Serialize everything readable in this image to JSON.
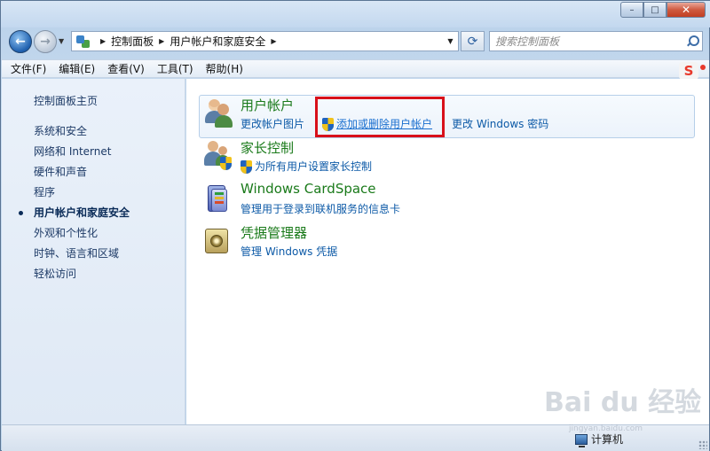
{
  "window": {
    "controls": {
      "minimize": "–",
      "maximize": "□",
      "close": "✕"
    }
  },
  "nav": {
    "back": "←",
    "forward": "→",
    "history_dropdown": "▼",
    "breadcrumb": [
      "控制面板",
      "用户帐户和家庭安全"
    ],
    "address_dropdown": "▼",
    "refresh": "⟳",
    "search_placeholder": "搜索控制面板"
  },
  "menubar": {
    "items": [
      "文件(F)",
      "编辑(E)",
      "查看(V)",
      "工具(T)",
      "帮助(H)"
    ],
    "ime_label": "S"
  },
  "sidebar": {
    "home": "控制面板主页",
    "items": [
      {
        "label": "系统和安全",
        "active": false
      },
      {
        "label": "网络和 Internet",
        "active": false
      },
      {
        "label": "硬件和声音",
        "active": false
      },
      {
        "label": "程序",
        "active": false
      },
      {
        "label": "用户帐户和家庭安全",
        "active": true
      },
      {
        "label": "外观和个性化",
        "active": false
      },
      {
        "label": "时钟、语言和区域",
        "active": false
      },
      {
        "label": "轻松访问",
        "active": false
      }
    ]
  },
  "main": {
    "categories": [
      {
        "title": "用户帐户",
        "icon": "user-accounts-icon",
        "links": [
          {
            "label": "更改帐户图片",
            "shield": false
          },
          {
            "label": "添加或删除用户帐户",
            "shield": true,
            "highlighted": true
          },
          {
            "label": "更改 Windows 密码",
            "shield": false
          }
        ]
      },
      {
        "title": "家长控制",
        "icon": "parental-controls-icon",
        "links": [
          {
            "label": "为所有用户设置家长控制",
            "shield": true
          }
        ]
      },
      {
        "title": "Windows CardSpace",
        "icon": "cardspace-icon",
        "links": [
          {
            "label": "管理用于登录到联机服务的信息卡",
            "shield": false
          }
        ]
      },
      {
        "title": "凭据管理器",
        "icon": "credential-manager-icon",
        "links": [
          {
            "label": "管理 Windows 凭据",
            "shield": false
          }
        ]
      }
    ]
  },
  "statusbar": {
    "computer_label": "计算机"
  },
  "watermark": {
    "text": "Bai du 经验",
    "sub": "jingyan.baidu.com"
  },
  "colors": {
    "category_title": "#1a7a1a",
    "link": "#0d5aa7",
    "highlight_box": "#d8101a",
    "sidebar_bg": "#eaf1fa"
  }
}
